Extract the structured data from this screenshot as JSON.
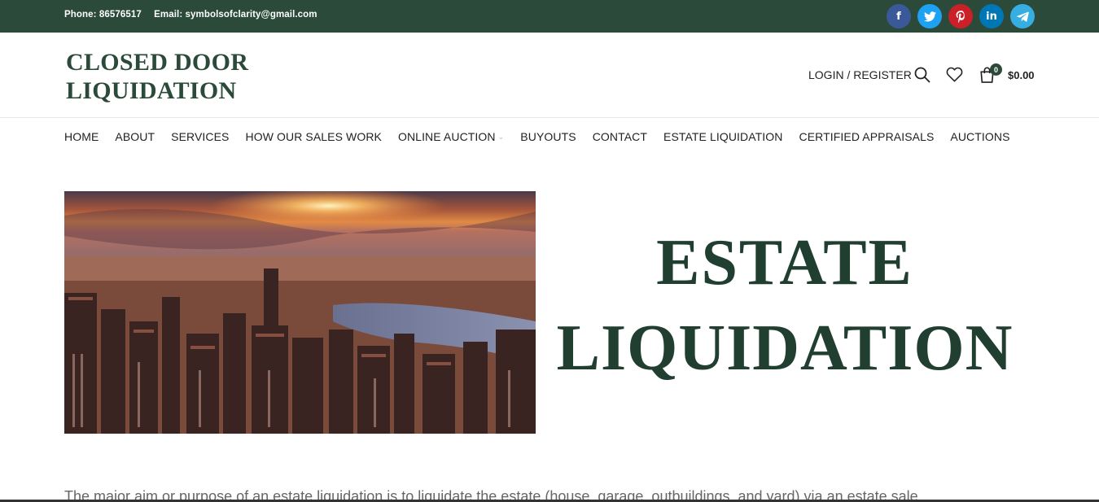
{
  "topbar": {
    "phone": "Phone: 86576517",
    "email": "Email: symbolsofclarity@gmail.com",
    "social": [
      {
        "name": "facebook",
        "glyph": "f",
        "color": "#3b5998"
      },
      {
        "name": "twitter",
        "glyph": "t",
        "color": "#1da1f2"
      },
      {
        "name": "pinterest",
        "glyph": "p",
        "color": "#cb2027"
      },
      {
        "name": "linkedin",
        "glyph": "in",
        "color": "#0077b5"
      },
      {
        "name": "telegram",
        "glyph": "➤",
        "color": "#37aee2"
      }
    ]
  },
  "header": {
    "logo_line1": "CLOSED DOOR",
    "logo_line2": "LIQUIDATION",
    "login": "LOGIN / REGISTER",
    "cart_count": "0",
    "cart_total": "$0.00"
  },
  "nav": {
    "items": [
      "HOME",
      "ABOUT",
      "SERVICES",
      "HOW OUR SALES WORK",
      "ONLINE AUCTION",
      "BUYOUTS",
      "CONTACT",
      "ESTATE LIQUIDATION",
      "CERTIFIED APPRAISALS",
      "AUCTIONS"
    ]
  },
  "hero": {
    "title_line1": "ESTATE",
    "title_line2": "LIQUIDATION"
  },
  "content": {
    "paragraph": "The major aim or purpose of an estate liquidation is to liquidate the estate (house, garage, outbuildings, and yard) via an estate sale."
  },
  "colors": {
    "brand": "#2b4a3a"
  }
}
